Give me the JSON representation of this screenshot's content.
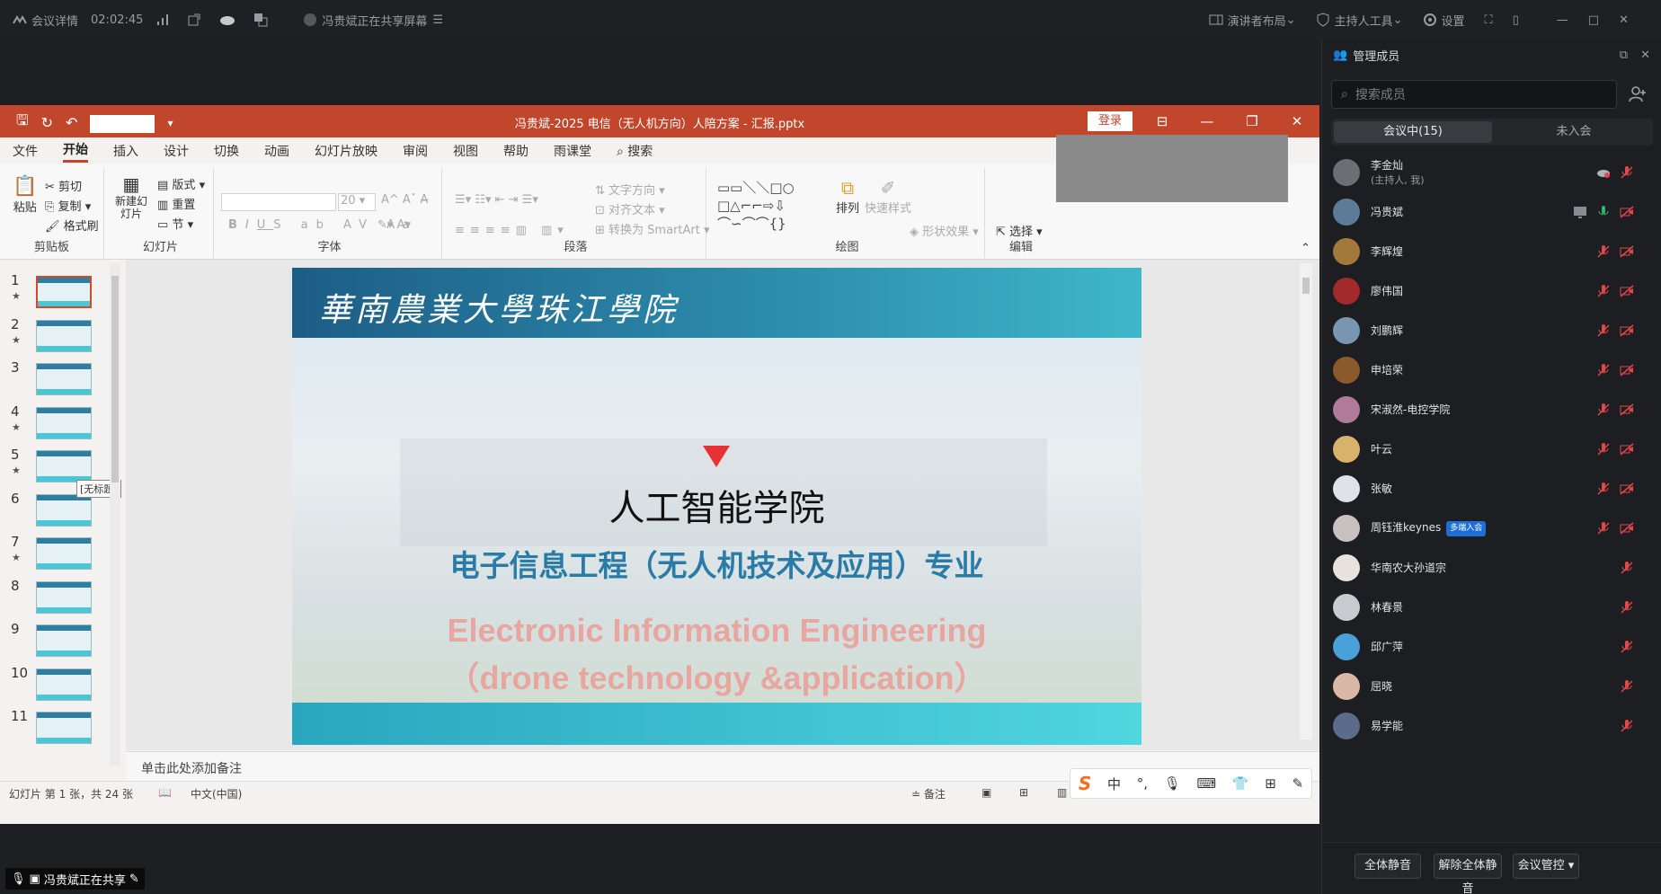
{
  "meeting_bar": {
    "meeting_info": "会议详情",
    "duration": "02:02:45",
    "sharing_notice": "冯贵斌正在共享屏幕",
    "presenter_layout": "演讲者布局",
    "host_tools": "主持人工具",
    "settings": "设置"
  },
  "ppt": {
    "filename": "冯贵斌-2025 电信（无人机方向）人陪方案 - 汇报.pptx",
    "login": "登录",
    "tabs": [
      "文件",
      "开始",
      "插入",
      "设计",
      "切换",
      "动画",
      "幻灯片放映",
      "审阅",
      "视图",
      "帮助",
      "雨课堂"
    ],
    "search": "搜索",
    "ribbon": {
      "paste": "粘贴",
      "cut": "剪切",
      "copy": "复制",
      "format_painter": "格式刷",
      "clipboard": "剪贴板",
      "new_slide": "新建幻灯片",
      "layout": "版式",
      "reset": "重置",
      "section": "节",
      "slides_group": "幻灯片",
      "font_size": "20",
      "font_group": "字体",
      "text_direction": "文字方向",
      "align_text": "对齐文本",
      "convert_smartart": "转换为 SmartArt",
      "paragraph_group": "段落",
      "arrange": "排列",
      "quick_styles": "快速样式",
      "shape_effects": "形状效果",
      "drawing_group": "绘图",
      "select": "选择",
      "editing_group": "编辑"
    },
    "thumbnails": [
      {
        "num": "1",
        "star": "★"
      },
      {
        "num": "2",
        "star": "★"
      },
      {
        "num": "3",
        "star": ""
      },
      {
        "num": "4",
        "star": "★"
      },
      {
        "num": "5",
        "star": "★"
      },
      {
        "num": "6",
        "star": ""
      },
      {
        "num": "7",
        "star": "★"
      },
      {
        "num": "8",
        "star": ""
      },
      {
        "num": "9",
        "star": ""
      },
      {
        "num": "10",
        "star": ""
      },
      {
        "num": "11",
        "star": ""
      }
    ],
    "thumb_tooltip": "[无标题]",
    "slide": {
      "school_name": "華南農業大學珠江學院",
      "title": "人工智能学院",
      "subtitle_cn": "电子信息工程（无人机技术及应用）专业",
      "subtitle_en_1": "Electronic Information Engineering",
      "subtitle_en_2": "（drone technology &application）"
    },
    "notes_placeholder": "单击此处添加备注",
    "status": {
      "slide_counter": "幻灯片 第 1 张，共 24 张",
      "language": "中文(中国)",
      "notes": "备注"
    },
    "ime": {
      "logo": "S",
      "mode": "中"
    }
  },
  "share_indicator": "冯贵斌正在共享",
  "panel": {
    "title": "管理成员",
    "search_placeholder": "搜索成员",
    "tab_in_meeting": "会议中(15)",
    "tab_not_joined": "未入会",
    "members": [
      {
        "name": "李金灿",
        "sub": "(主持人, 我)",
        "color": "#6b6e75",
        "icons": [
          "cloud-record",
          "mic-off"
        ]
      },
      {
        "name": "冯贵斌",
        "color": "#5d7a99",
        "icons": [
          "screen-share",
          "mic-on",
          "video-off"
        ]
      },
      {
        "name": "李辉煌",
        "color": "#a3793b",
        "icons": [
          "mic-off",
          "video-off"
        ]
      },
      {
        "name": "廖伟国",
        "color": "#a22a2a",
        "icons": [
          "mic-off",
          "video-off"
        ]
      },
      {
        "name": "刘鹏辉",
        "color": "#7a95b0",
        "icons": [
          "mic-off",
          "video-off"
        ]
      },
      {
        "name": "申培荣",
        "color": "#8b5a2b",
        "icons": [
          "mic-off",
          "video-off"
        ]
      },
      {
        "name": "宋淑然-电控学院",
        "color": "#b07a9a",
        "icons": [
          "mic-off",
          "video-off"
        ]
      },
      {
        "name": "叶云",
        "color": "#d7b26a",
        "icons": [
          "mic-off",
          "video-off"
        ]
      },
      {
        "name": "张敏",
        "color": "#dfe3e8",
        "icons": [
          "mic-off",
          "video-off"
        ]
      },
      {
        "name": "周钰淮keynes",
        "badge": "多端入会",
        "color": "#c9c0c2",
        "icons": [
          "mic-off",
          "video-off"
        ]
      },
      {
        "name": "华南农大孙道宗",
        "color": "#e8e2dc",
        "icons": [
          "mic-off"
        ]
      },
      {
        "name": "林春景",
        "color": "#c8ccd0",
        "icons": [
          "mic-off"
        ]
      },
      {
        "name": "邱广萍",
        "color": "#4aa0d8",
        "icons": [
          "mic-off"
        ]
      },
      {
        "name": "屈晓",
        "color": "#d9b8a8",
        "icons": [
          "mic-off"
        ]
      },
      {
        "name": "易学能",
        "color": "#5a6b8c",
        "icons": [
          "mic-off"
        ]
      }
    ],
    "footer": {
      "mute_all": "全体静音",
      "unmute_all": "解除全体静音",
      "meeting_control": "会议管控"
    }
  }
}
